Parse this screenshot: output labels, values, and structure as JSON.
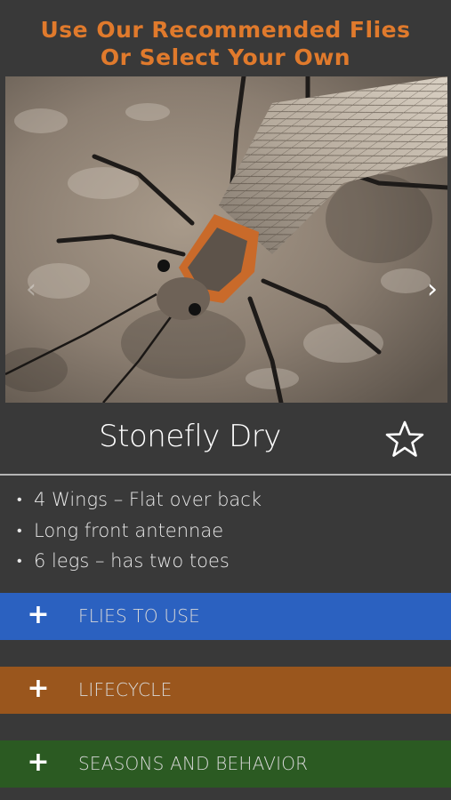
{
  "header": {
    "line1": "Use Our Recommended Flies",
    "line2": "Or Select Your Own"
  },
  "carousel": {
    "image": "stonefly-photo",
    "prev_icon": "chevron-left-icon",
    "next_icon": "chevron-right-icon"
  },
  "fly": {
    "name": "Stonefly Dry",
    "favorite_icon": "star-outline-icon"
  },
  "traits": [
    "4 Wings – Flat over back",
    "Long front antennae",
    "6 legs – has two toes"
  ],
  "sections": [
    {
      "label": "FLIES TO USE",
      "color": "#2b61c0",
      "icon": "plus-icon"
    },
    {
      "label": "LIFECYCLE",
      "color": "#9a561d",
      "icon": "plus-icon"
    },
    {
      "label": "SEASONS AND BEHAVIOR",
      "color": "#2b5a22",
      "icon": "plus-icon"
    }
  ],
  "colors": {
    "background": "#393939",
    "header_text": "#e07a2c"
  }
}
